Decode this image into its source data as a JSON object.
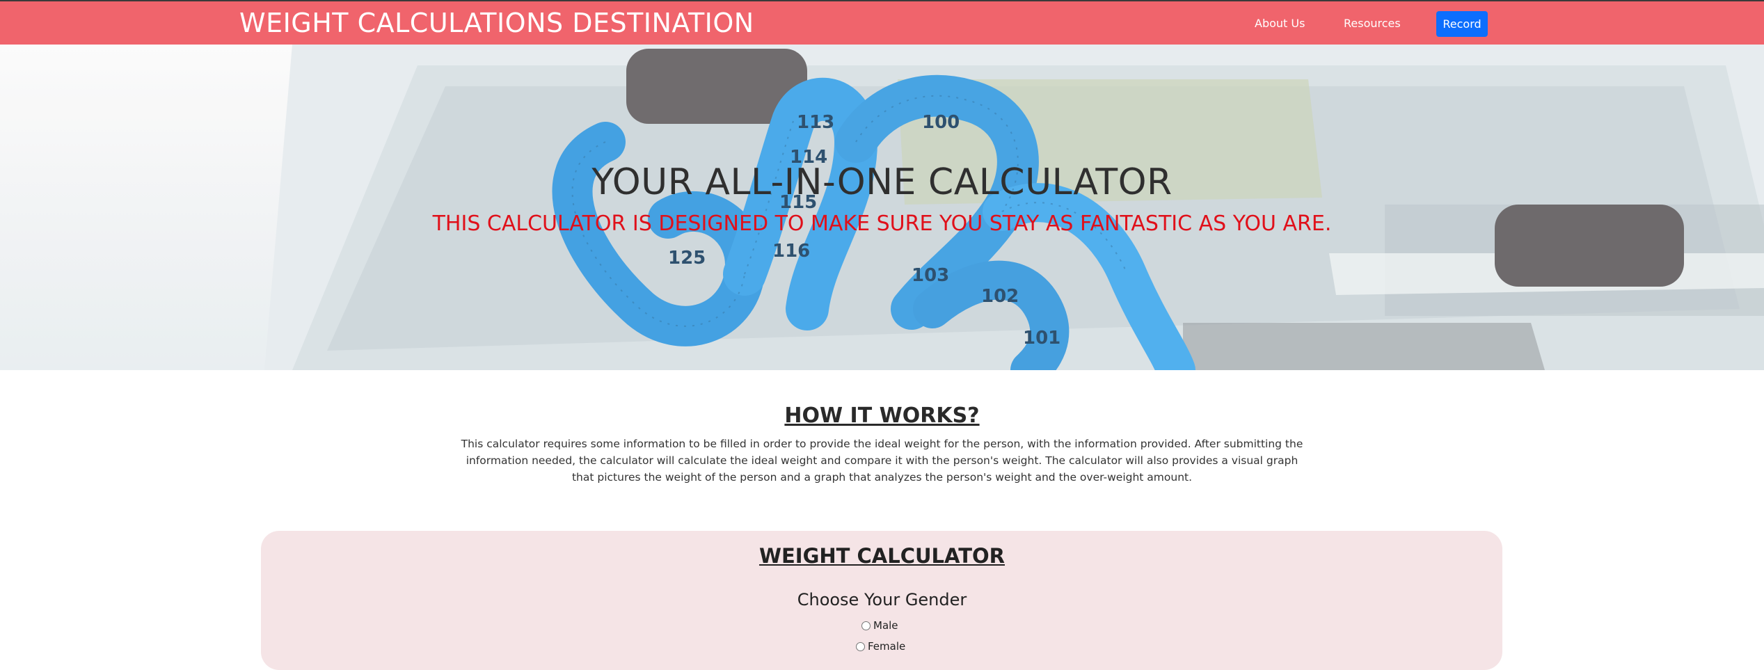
{
  "nav": {
    "brand": "WEIGHT CALCULATIONS DESTINATION",
    "links": [
      "About Us",
      "Resources"
    ],
    "record_label": "Record",
    "bg_color": "#f0646c",
    "record_color": "#0d6efd"
  },
  "hero": {
    "title": "YOUR ALL-IN-ONE CALCULATOR",
    "subtitle": "THIS CALCULATOR IS DESIGNED TO MAKE SURE YOU STAY AS FANTASTIC AS YOU ARE.",
    "tape_numbers": [
      "113",
      "114",
      "100",
      "115",
      "116",
      "125",
      "103",
      "102",
      "101"
    ]
  },
  "how": {
    "title": "HOW IT WORKS?",
    "text": "This calculator requires some information to be filled in order to provide the ideal weight for the person, with the information provided. After submitting the information needed, the calculator will calculate the ideal weight and compare it with the person's weight. The calculator will also provides a visual graph that pictures the weight of the person and a graph that analyzes the person's weight and the over-weight amount."
  },
  "calculator": {
    "title": "WEIGHT CALCULATOR",
    "gender_label": "Choose Your Gender",
    "options": [
      "Male",
      "Female"
    ],
    "panel_color": "#f5e4e6"
  }
}
